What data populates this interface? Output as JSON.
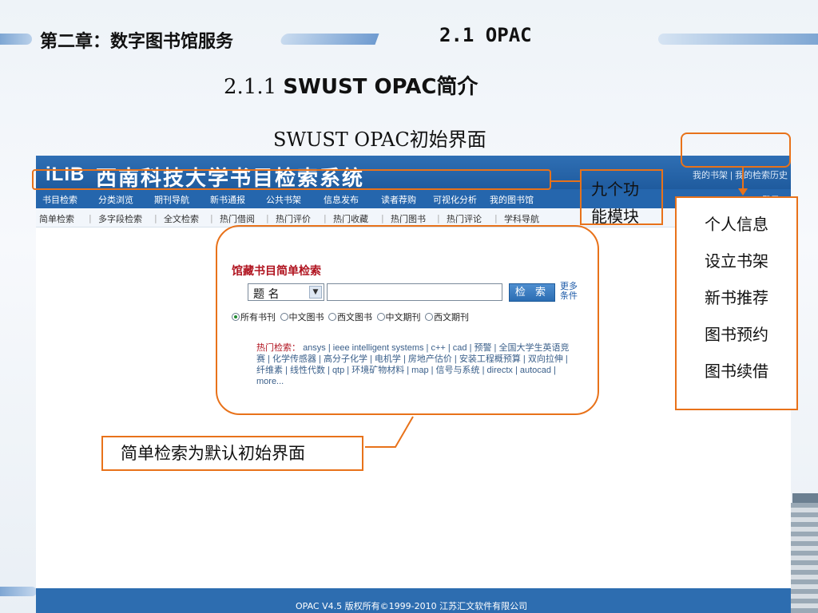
{
  "slide": {
    "chapter": "第二章：数字图书馆服务",
    "section": "2.1  OPAC",
    "subsection_num": "2.1.1",
    "subsection_title": "SWUST OPAC简介",
    "screen_title": "SWUST OPAC初始界面"
  },
  "opac": {
    "logo": "iLIB",
    "system_name": "西南科技大学书目检索系统",
    "top_links": "我的书架 | 我的检索历史",
    "login": "登录",
    "nav": [
      "书目检索",
      "分类浏览",
      "期刊导航",
      "新书通报",
      "公共书架",
      "信息发布",
      "读者荐购",
      "可视化分析",
      "我的图书馆"
    ],
    "subnav": [
      "简单检索",
      "多字段检索",
      "全文检索",
      "热门借阅",
      "热门评价",
      "热门收藏",
      "热门图书",
      "热门评论",
      "学科导航"
    ],
    "search": {
      "title": "馆藏书目简单检索",
      "field": "题 名",
      "input_value": "",
      "button": "检 索",
      "more": "更多条件",
      "radios": [
        {
          "label": "所有书刊",
          "checked": true
        },
        {
          "label": "中文图书",
          "checked": false
        },
        {
          "label": "西文图书",
          "checked": false
        },
        {
          "label": "中文期刊",
          "checked": false
        },
        {
          "label": "西文期刊",
          "checked": false
        }
      ],
      "hot_label": "热门检索：",
      "hot_text": "ansys | ieee intelligent systems | c++ | cad | 预警 | 全国大学生英语竞赛 | 化学传感器 | 高分子化学 | 电机学 | 房地产估价 | 安装工程概预算 | 双向拉伸 | 纤维素 | 线性代数 | qtp | 环境矿物材料 | map | 信号与系统 | directx | autocad | more..."
    },
    "footer": "OPAC V4.5    版权所有©1999-2010 江苏汇文软件有限公司"
  },
  "annotations": {
    "nine_modules_1": "九个功",
    "nine_modules_2": "能模块",
    "personal": [
      "个人信息",
      "设立书架",
      "新书推荐",
      "图书预约",
      "图书续借"
    ],
    "default_note": "简单检索为默认初始界面"
  },
  "colors": {
    "accent": "#e8721a",
    "header_blue": "#2566ad",
    "title_red": "#b0131f"
  }
}
